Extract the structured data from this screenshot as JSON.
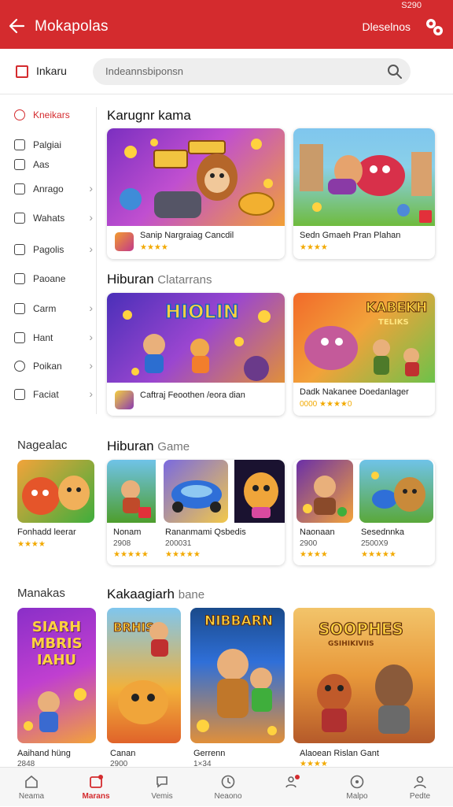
{
  "status": {
    "text": "S290"
  },
  "app": {
    "title": "Mokapolas",
    "header_right": "Dleselnos"
  },
  "filter": {
    "checkbox_label": "Inkaru",
    "search_placeholder": "Indeannsbiponsn"
  },
  "sidebar": {
    "items": [
      {
        "label": "Kneikars",
        "active": true,
        "chevron": false
      },
      {
        "label": "Palgiai",
        "chevron": false
      },
      {
        "label": "Aas",
        "chevron": false
      },
      {
        "label": "Anrago",
        "chevron": true
      },
      {
        "label": "Wahats",
        "chevron": true
      },
      {
        "label": "Pagolis",
        "chevron": true
      },
      {
        "label": "Paoane",
        "chevron": false
      },
      {
        "label": "Carm",
        "chevron": true
      },
      {
        "label": "Hant",
        "chevron": true
      },
      {
        "label": "Poikan",
        "chevron": true
      },
      {
        "label": "Faciat",
        "chevron": true
      }
    ]
  },
  "section1": {
    "title": "Karugnr kama",
    "cards": [
      {
        "title": "Sanip Nargraiag Cancdil",
        "rating": "★★★★"
      },
      {
        "title": "Sedn Gmaeh Pran Plahan",
        "rating": "★★★★"
      }
    ]
  },
  "section2": {
    "title": "Hiburan",
    "subtitle": "Clatarrans",
    "banner_text_left": "HIOLIN",
    "banner_text_right": "KABEKH",
    "banner_sub_right": "TELIKS",
    "cards": [
      {
        "title": "Caftraj Feoothen /eora dian",
        "rating": ""
      },
      {
        "title": "Dadk Nakanee Doedanlager",
        "rating": "0000 ★★★★0"
      }
    ]
  },
  "section3": {
    "side_title": "Nagealac",
    "title": "Hiburan",
    "subtitle": "Game",
    "side_tile": {
      "label": "Fonhadd leerar",
      "rating": "★★★★"
    },
    "card_a": {
      "items": [
        {
          "name": "Nonam",
          "num": "2908",
          "rating": "★★★★★"
        },
        {
          "name": "Rananmami Qsbedis",
          "num": "200031",
          "rating": "★★★★★"
        }
      ]
    },
    "card_b": {
      "items": [
        {
          "name": "Naonaan",
          "num": "2900",
          "rating": "★★★★"
        },
        {
          "name": "Sesednnka",
          "num": "2500X9",
          "rating": "★★★★★"
        }
      ]
    }
  },
  "section4": {
    "side_title": "Manakas",
    "title": "Kakaagiarh",
    "subtitle": "bane",
    "tiles": [
      {
        "poster": "SIARH MBRIS IAHU",
        "label": "Aaihand hüng",
        "num": "2848"
      },
      {
        "poster": "BRHIS",
        "label": "Canan",
        "num": "2900"
      },
      {
        "poster": "NIBBARN",
        "label": "Gerrenn",
        "num": "1×34"
      },
      {
        "poster": "SOOPHES",
        "poster_sub": "GSIHIKIVIIS",
        "label": "Alaoean Rislan Gant",
        "num": "★★★★"
      }
    ]
  },
  "nav": {
    "items": [
      {
        "label": "Neama",
        "icon": "home-icon"
      },
      {
        "label": "Marans",
        "icon": "store-icon",
        "active": true
      },
      {
        "label": "Vemis",
        "icon": "chat-icon"
      },
      {
        "label": "Neaono",
        "icon": "clock-icon"
      },
      {
        "label": "",
        "icon": "people-icon"
      },
      {
        "label": "Malpo",
        "icon": "help-icon"
      },
      {
        "label": "Pedte",
        "icon": "profile-icon"
      }
    ]
  },
  "colors": {
    "brand": "#d42b2e",
    "star": "#f2a900"
  }
}
